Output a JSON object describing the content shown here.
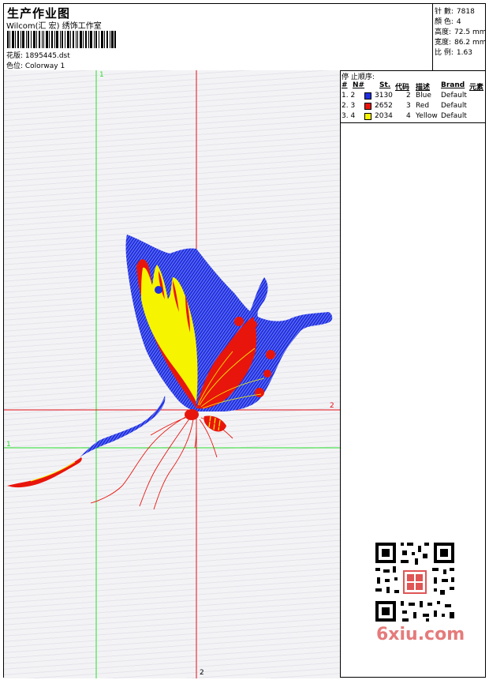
{
  "header": {
    "title": "生产作业图",
    "company": "Wilcom(汇 宏) 绣饰工作室",
    "design_file_label": "花版: 1895445.dst",
    "colorway_label": "色位: Colorway 1"
  },
  "stats": [
    {
      "label": "针 數:",
      "value": "7818"
    },
    {
      "label": "顏 色:",
      "value": "4"
    },
    {
      "label": "高度:",
      "value": "72.5 mm"
    },
    {
      "label": "宽度:",
      "value": "86.2 mm"
    },
    {
      "label": "比 例:",
      "value": "1.63"
    }
  ],
  "stop_sequence": {
    "title": "停 止顺序:",
    "columns": [
      "#",
      "N#",
      "St.",
      "代码",
      "描述",
      "Brand",
      "元素"
    ],
    "rows": [
      {
        "index": "1. 2",
        "stitches": "3130",
        "code": "2",
        "description": "Blue",
        "brand": "Default",
        "color": "#1f2fe0"
      },
      {
        "index": "2. 3",
        "stitches": "2652",
        "code": "3",
        "description": "Red",
        "brand": "Default",
        "color": "#e8150c"
      },
      {
        "index": "3. 4",
        "stitches": "2034",
        "code": "4",
        "description": "Yellow",
        "brand": "Default",
        "color": "#f7f400"
      }
    ]
  },
  "axes": {
    "green_label_top": "1",
    "green_label_left": "1",
    "red_label_right": "2",
    "red_label_bottom": "2",
    "green_color": "#2bdc2b",
    "red_color": "#e60f14"
  },
  "watermark": {
    "text": "6xiu.com"
  }
}
